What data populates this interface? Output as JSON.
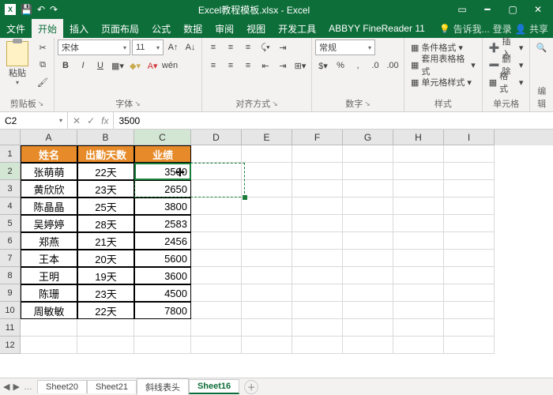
{
  "titlebar": {
    "app_icon_text": "X",
    "title": "Excel教程模板.xlsx - Excel"
  },
  "tabs": {
    "file": "文件",
    "home": "开始",
    "insert": "插入",
    "layout": "页面布局",
    "formulas": "公式",
    "data": "数据",
    "review": "审阅",
    "view": "视图",
    "devtools": "开发工具",
    "abbyy": "ABBYY FineReader 11",
    "tellme": "告诉我...",
    "signin": "登录",
    "share": "共享"
  },
  "ribbon": {
    "paste": "粘贴",
    "clipboard": "剪贴板",
    "font_name": "宋体",
    "font_size": "11",
    "font_group": "字体",
    "align_group": "对齐方式",
    "number_format": "常规",
    "number_group": "数字",
    "cond_format": "条件格式",
    "table_format": "套用表格格式",
    "cell_styles": "单元格样式",
    "styles_group": "样式",
    "insert": "插入",
    "delete": "删除",
    "format": "格式",
    "cells_group": "单元格",
    "editing_group": "编辑"
  },
  "formula_bar": {
    "name_box": "C2",
    "fx": "fx",
    "value": "3500"
  },
  "columns": [
    "A",
    "B",
    "C",
    "D",
    "E",
    "F",
    "G",
    "H",
    "I"
  ],
  "headers": [
    "姓名",
    "出勤天数",
    "业绩"
  ],
  "rows": [
    {
      "name": "张萌萌",
      "days": "22天",
      "perf": "3500"
    },
    {
      "name": "黄欣欣",
      "days": "23天",
      "perf": "2650"
    },
    {
      "name": "陈晶晶",
      "days": "25天",
      "perf": "3800"
    },
    {
      "name": "吴婷婷",
      "days": "28天",
      "perf": "2583"
    },
    {
      "name": "郑燕",
      "days": "21天",
      "perf": "2456"
    },
    {
      "name": "王本",
      "days": "20天",
      "perf": "5600"
    },
    {
      "name": "王明",
      "days": "19天",
      "perf": "3600"
    },
    {
      "name": "陈珊",
      "days": "23天",
      "perf": "4500"
    },
    {
      "name": "周敏敏",
      "days": "22天",
      "perf": "7800"
    }
  ],
  "sheets": {
    "s1": "Sheet20",
    "s2": "Sheet21",
    "s3": "斜线表头",
    "active": "Sheet16"
  },
  "chart_data": null
}
